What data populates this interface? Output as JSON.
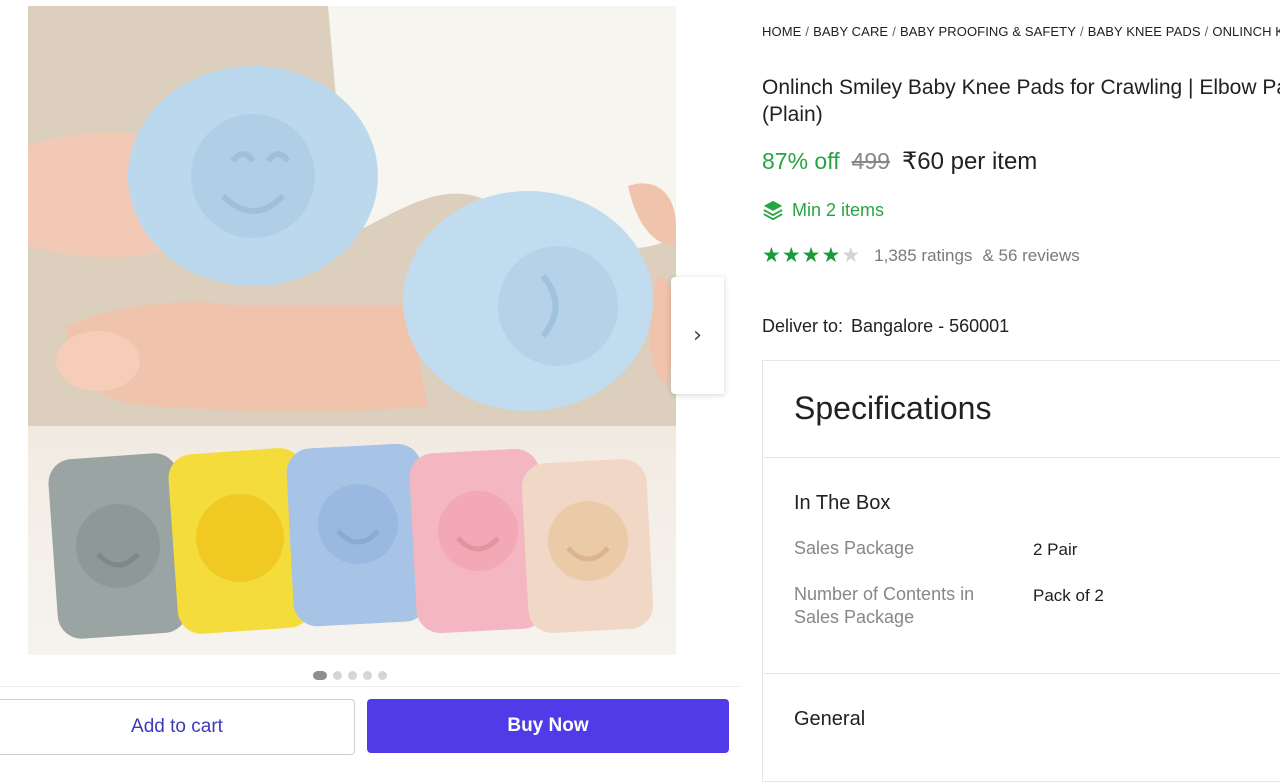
{
  "breadcrumbs": [
    "HOME",
    "BABY CARE",
    "BABY PROOFING & SAFETY",
    "BABY KNEE PADS",
    "ONLINCH K"
  ],
  "product": {
    "title": "Onlinch Smiley Baby Knee Pads for Crawling | Elbow Pads (Plain)",
    "discount": "87% off",
    "mrp": "499",
    "price": "₹60 per item",
    "min_order": "Min 2 items",
    "rating_stars": 4,
    "ratings_count": "1,385 ratings",
    "reviews_count": "& 56 reviews"
  },
  "delivery": {
    "label": "Deliver to:",
    "location": "Bangalore - 560001"
  },
  "actions": {
    "add_to_cart": "Add to cart",
    "buy_now": "Buy Now"
  },
  "gallery": {
    "image_count": 5,
    "active_index": 0
  },
  "specifications": {
    "title": "Specifications",
    "groups": [
      {
        "title": "In The Box",
        "rows": [
          {
            "label": "Sales Package",
            "value": "2 Pair"
          },
          {
            "label": "Number of Contents in Sales Package",
            "value": "Pack of 2"
          }
        ]
      },
      {
        "title": "General",
        "rows": []
      }
    ]
  },
  "colors": {
    "accent": "#4f3ce8",
    "discount_green": "#26a541",
    "star_green": "#1a9b3a"
  },
  "icons": {
    "next": "chevron-right-icon",
    "min": "layers-icon",
    "star": "star-icon"
  }
}
